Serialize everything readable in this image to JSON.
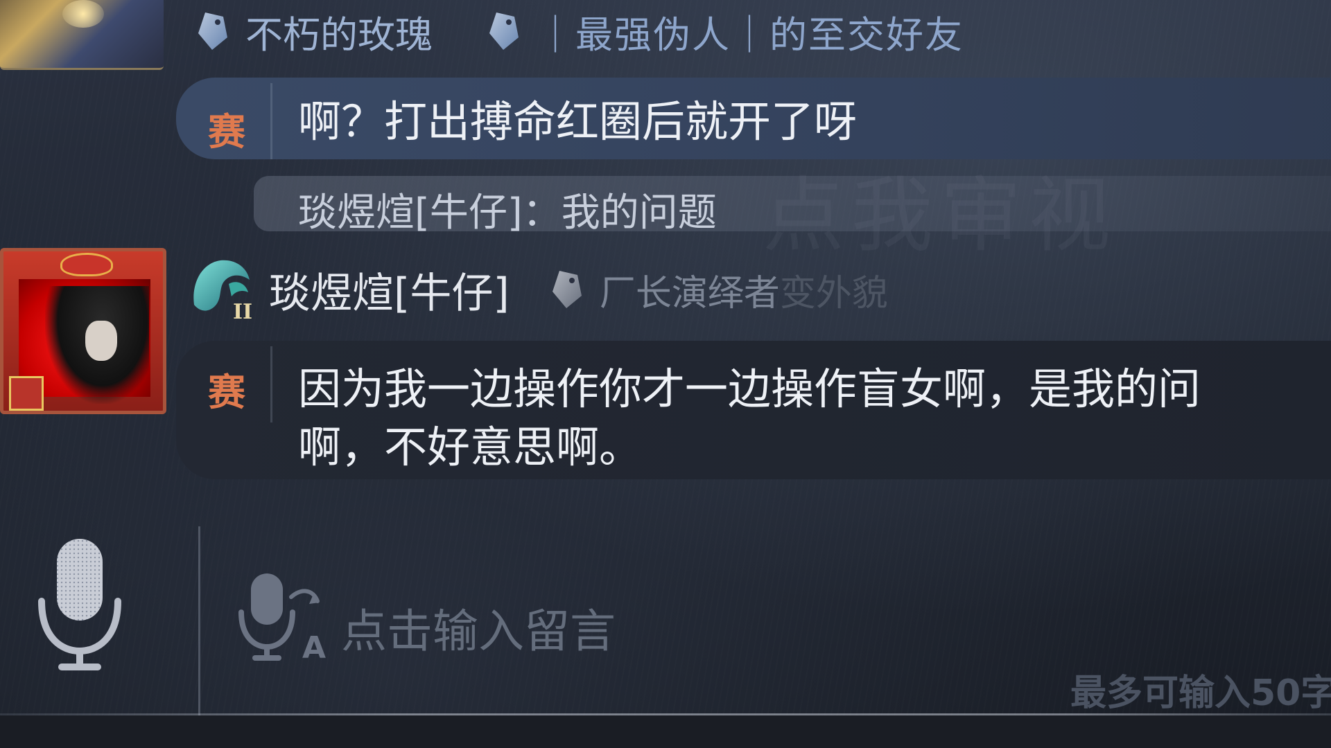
{
  "background_watermark": "点我审视",
  "message_top_sender": {
    "rose_title": "不朽的玫瑰",
    "friend_title": "｜最强伪人｜的至交好友"
  },
  "message_1": {
    "badge": "赛",
    "text": "啊？打出搏命红圈后就开了呀"
  },
  "quoted_reply": {
    "text": "琰煜煊[牛仔]：我的问题"
  },
  "message_2_sender": {
    "name": "琰煜煊[牛仔]",
    "role_title": "厂长演绎者",
    "faded_suffix": "变外貌",
    "rank_badge_label": "II"
  },
  "message_2": {
    "badge": "赛",
    "line1": "因为我一边操作你才一边操作盲女啊，是我的问",
    "line2": "啊，不好意思啊。"
  },
  "input": {
    "placeholder": "点击输入留言",
    "char_limit_hint": "最多可输入50字"
  },
  "icons": {
    "tag": "tag-icon",
    "mic": "microphone-icon",
    "voice_to_text": "voice-to-text-icon",
    "rank": "rank-badge-icon"
  },
  "colors": {
    "badge_orange": "#e07a4e",
    "bubble_highlight": "#3a4a66",
    "bubble_dark": "#232833",
    "title_blue": "#9fb4d4"
  }
}
